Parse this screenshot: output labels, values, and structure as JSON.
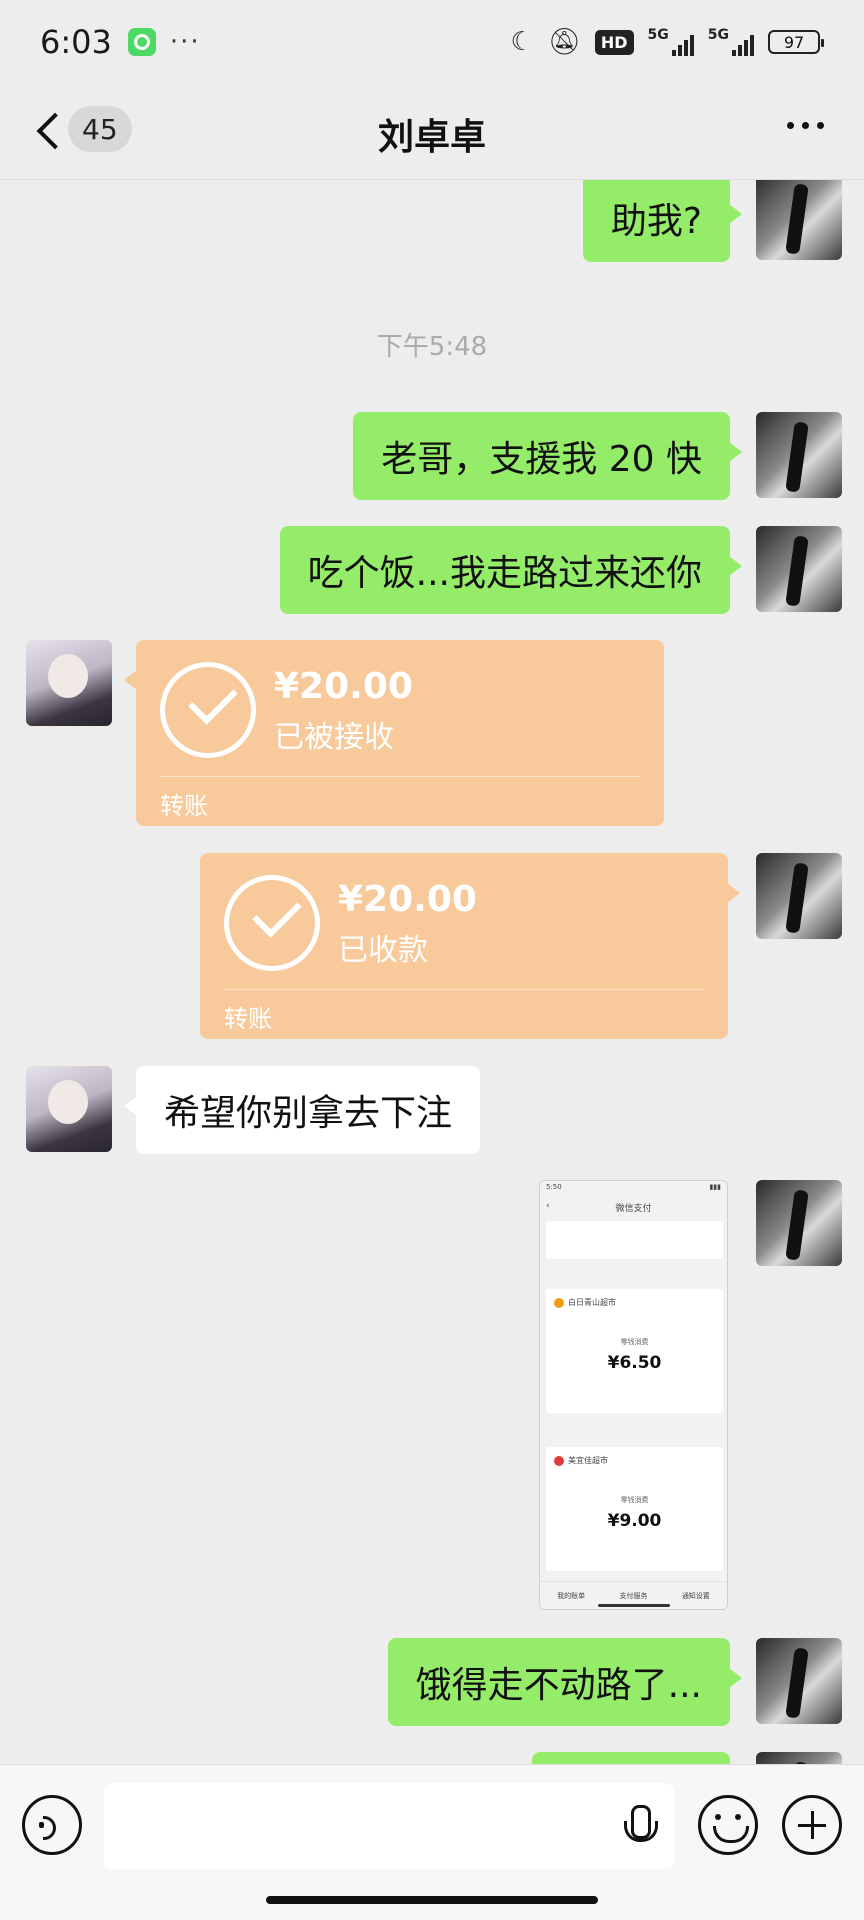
{
  "status_bar": {
    "time": "6:03",
    "more": "···",
    "hd": "HD",
    "network_1": "5G",
    "network_2": "5G",
    "battery": "97"
  },
  "header": {
    "unread_count": "45",
    "title": "刘卓卓"
  },
  "messages": {
    "m0": "助我?",
    "timestamp": "下午5:48",
    "m1": "老哥，支援我 20 快",
    "m2": "吃个饭...我走路过来还你",
    "t1": {
      "amount": "¥20.00",
      "status": "已被接收",
      "label": "转账"
    },
    "t2": {
      "amount": "¥20.00",
      "status": "已收款",
      "label": "转账"
    },
    "m3": "希望你别拿去下注",
    "m4": "饿得走不动路了..."
  },
  "screenshot_image": {
    "time": "5:50",
    "title": "微信支付",
    "card1_merchant": "白日青山超市",
    "card1_sub": "零钱消费",
    "card1_amount": "¥6.50",
    "card2_merchant": "美宜佳超市",
    "card2_sub": "零钱消费",
    "card2_amount": "¥9.00",
    "tabs": [
      "我的账单",
      "支付服务",
      "通知设置"
    ]
  },
  "input_bar": {
    "placeholder": ""
  },
  "colors": {
    "self_bubble": "#95ec69",
    "transfer": "#f8c99b",
    "background": "#ededed"
  }
}
